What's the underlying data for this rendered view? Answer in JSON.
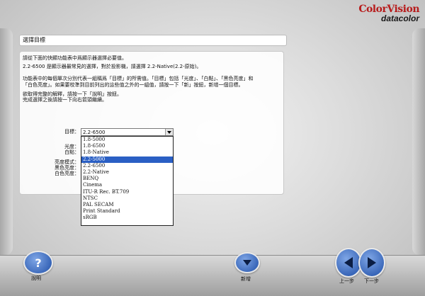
{
  "brand": {
    "line1": "ColorVision",
    "line2": "datacolor"
  },
  "page_title": "選擇目標",
  "instructions": {
    "p1": "請從下面的快顯功能表中爲顯示器選擇必要值。",
    "p2": "2.2-6500 是顯示器最常見的選擇，對於投影機，請選擇 2.2-Native(2.2-原始)。",
    "p3a": "功能表中的每個單次分別代表一組稱爲「目標」的所需值。「目標」包括「光度」、「白點」、「黑色亮度」和",
    "p3b": "「白色亮度」。如果要校準到目前列出的這些值之外的一組值，請按一下「新」按鈕，新增一個目標。",
    "p4a": "欲取得完整的解釋，請按一下「說明」按鈕。",
    "p4b": "完成選擇之後請按一下向右箭頭繼續。"
  },
  "form": {
    "target_label": "目標：",
    "gamma_label": "光度：",
    "whitepoint_label": "白點：",
    "contrast_label": "亮度模式：",
    "black_label": "黑色亮度：",
    "white_label": "白色亮度：",
    "target_value": "2.2-6500"
  },
  "dropdown_options": [
    "1.8-5000",
    "1.8-6500",
    "1.8-Native",
    "2.2-5000",
    "2.2-6500",
    "2.2-Native",
    "BENQ",
    "Cinema",
    "ITU-R Rec. BT.709",
    "NTSC",
    "PAL SECAM",
    "Print Standard",
    "sRGB"
  ],
  "selected_option_index": 3,
  "buttons": {
    "help": "說明",
    "new": "新增",
    "prev": "上一步",
    "next": "下一步"
  },
  "colors": {
    "accent_blue": "#2a5fc4",
    "brand_red": "#b71c1c"
  }
}
